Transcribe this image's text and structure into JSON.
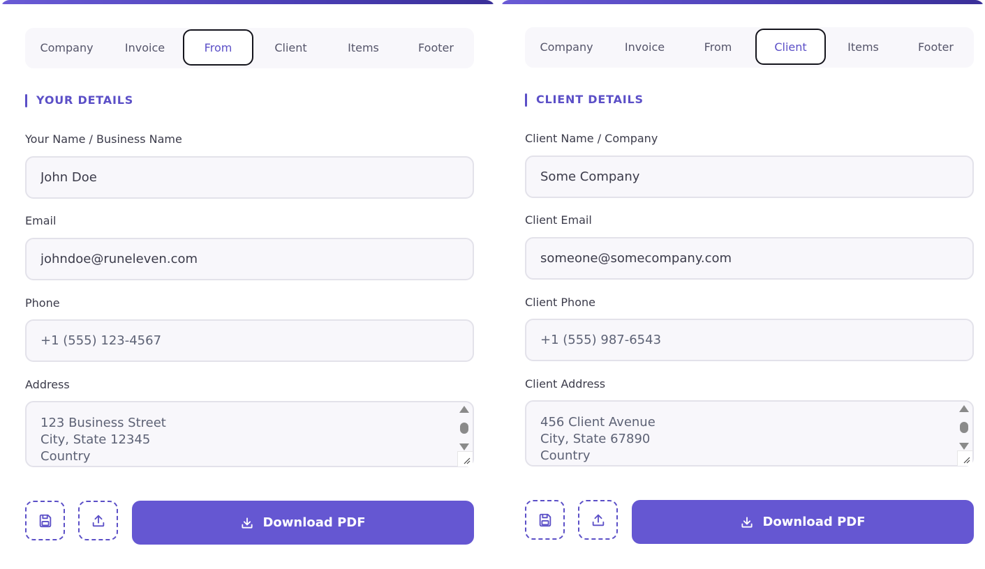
{
  "accent_color": "#5b4fc7",
  "button_color": "#6557d2",
  "left_panel": {
    "tabs": [
      "Company",
      "Invoice",
      "From",
      "Client",
      "Items",
      "Footer"
    ],
    "active_tab": "From",
    "section_title": "YOUR DETAILS",
    "fields": {
      "name_label": "Your Name / Business Name",
      "name_value": "John Doe",
      "email_label": "Email",
      "email_value": "johndoe@runeleven.com",
      "phone_label": "Phone",
      "phone_value": "+1 (555) 123-4567",
      "address_label": "Address",
      "address_value": "123 Business Street\nCity, State 12345\nCountry"
    },
    "download_label": "Download PDF"
  },
  "right_panel": {
    "tabs": [
      "Company",
      "Invoice",
      "From",
      "Client",
      "Items",
      "Footer"
    ],
    "active_tab": "Client",
    "section_title": "CLIENT DETAILS",
    "fields": {
      "name_label": "Client Name / Company",
      "name_value": "Some Company",
      "email_label": "Client Email",
      "email_value": "someone@somecompany.com",
      "phone_label": "Client Phone",
      "phone_value": "+1 (555) 987-6543",
      "address_label": "Client Address",
      "address_value": "456 Client Avenue\nCity, State 67890\nCountry"
    },
    "download_label": "Download PDF"
  },
  "icons": {
    "save": "save-icon",
    "upload": "upload-icon",
    "download": "download-icon"
  }
}
